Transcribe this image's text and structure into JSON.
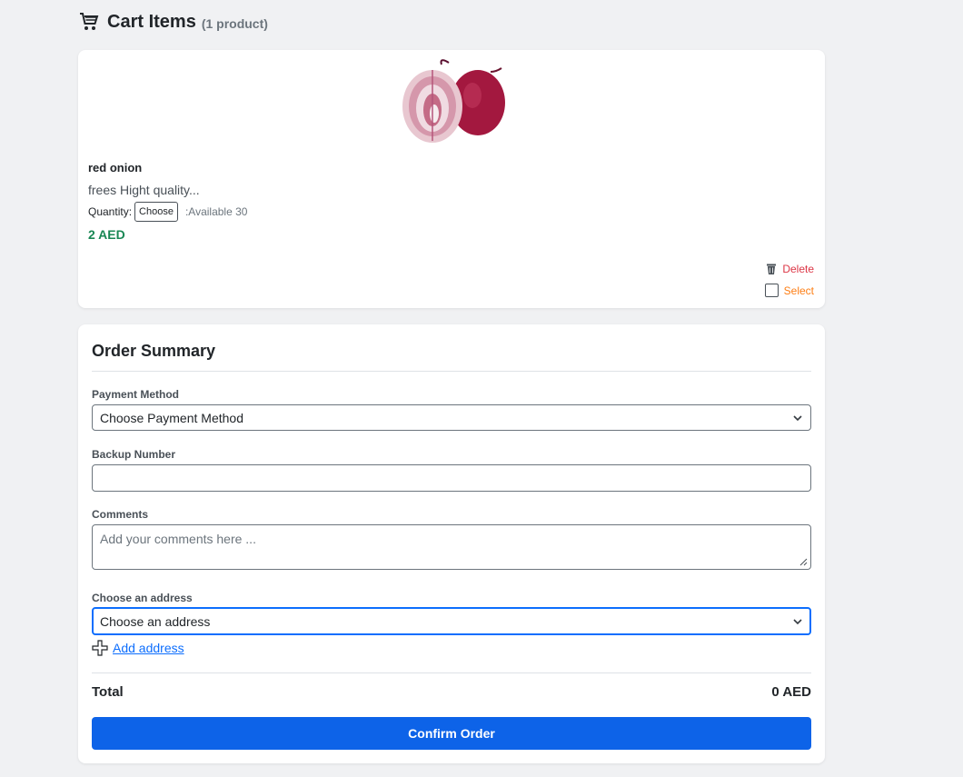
{
  "header": {
    "title": "Cart Items",
    "count": "(1 product)",
    "icon": "shopping-cart-icon"
  },
  "product": {
    "image": "red-onion-image",
    "name": "red onion",
    "description": "frees Hight quality...",
    "quantity_label": "Quantity:",
    "quantity_value": "Choose",
    "available": ":Available 30",
    "price": "2 AED",
    "delete_label": "Delete",
    "select_label": "Select"
  },
  "summary": {
    "title": "Order Summary",
    "payment_label": "Payment Method",
    "payment_value": "Choose Payment Method",
    "backup_label": "Backup Number",
    "backup_value": "",
    "comments_label": "Comments",
    "comments_placeholder": "Add your comments here ...",
    "address_label": "Choose an address",
    "address_value": "Choose an address",
    "add_address": "Add address",
    "total_label": "Total",
    "total_value": "0 AED",
    "confirm_label": "Confirm Order"
  },
  "colors": {
    "price_green": "#198754",
    "delete_red": "#dc3545",
    "select_orange": "#fd7e14",
    "primary_blue": "#0d63e8",
    "link_blue": "#0d6efd"
  }
}
